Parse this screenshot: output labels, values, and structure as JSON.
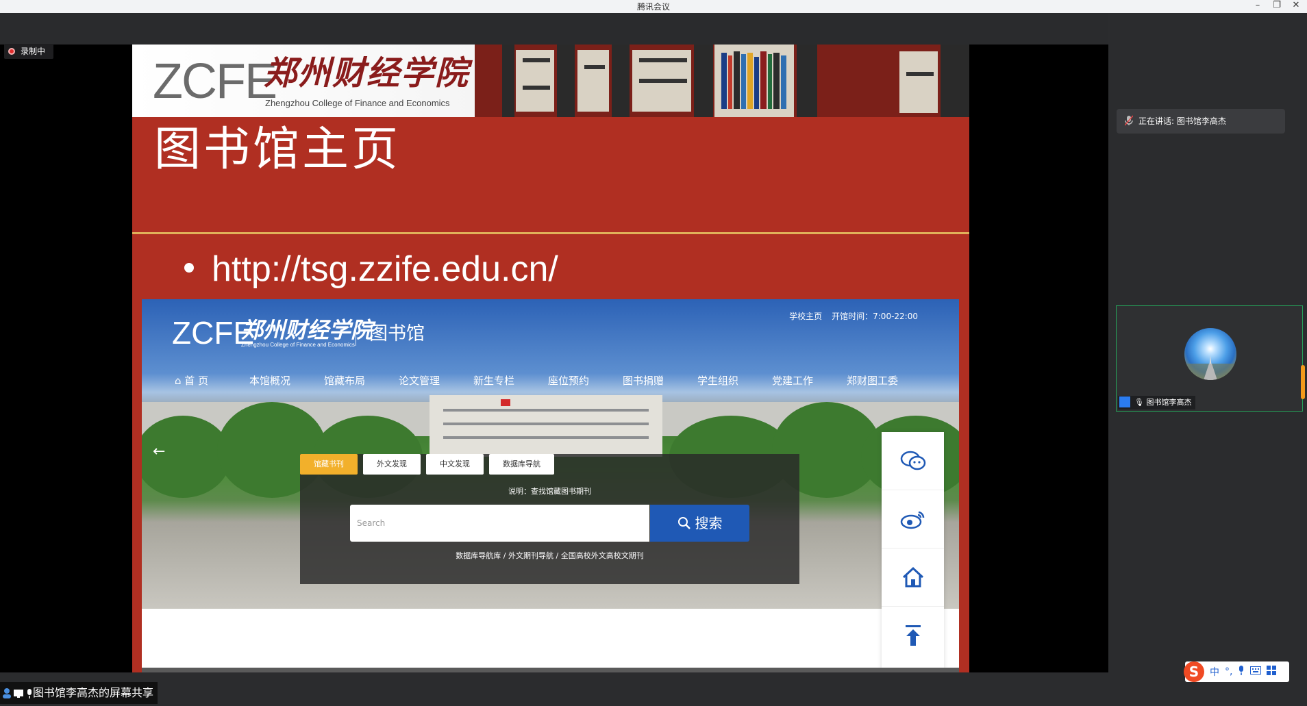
{
  "window": {
    "title": "腾讯会议",
    "controls": [
      "minimize-icon",
      "restore-icon",
      "close-icon"
    ]
  },
  "recording": {
    "label": "录制中",
    "color": "#e02b2b"
  },
  "slide": {
    "banner": {
      "logo_latin": "ZCFE",
      "logo_cn": "郑州财经学院",
      "logo_en": "Zhengzhou College of Finance and Economics"
    },
    "title": "图书馆主页",
    "bullet_url": "http://tsg.zzife.edu.cn/",
    "website": {
      "logo_latin": "ZCFE",
      "logo_cn": "郑州财经学院",
      "logo_en": "Zhengzhou College of Finance and Economics",
      "section": "图书馆",
      "top_links": [
        "学校主页",
        "开馆时间：7:00-22:00"
      ],
      "nav": [
        "首 页",
        "本馆概况",
        "馆藏布局",
        "论文管理",
        "新生专栏",
        "座位预约",
        "图书捐赠",
        "学生组织",
        "党建工作",
        "郑财图工委"
      ],
      "search": {
        "tabs": [
          "馆藏书刊",
          "外文发现",
          "中文发现",
          "数据库导航"
        ],
        "active_tab": "馆藏书刊",
        "description": "说明：查找馆藏图书期刊",
        "placeholder": "Search",
        "button": "搜索",
        "links": "数据库导航库 / 外文期刊导航 / 全国高校外文高校文期刊"
      },
      "float_icons": [
        "wechat-icon",
        "weibo-icon",
        "home-icon",
        "back-to-top-icon"
      ]
    }
  },
  "right_panel": {
    "speaking": "正在讲话: 图书馆李高杰",
    "participant_name": "图书馆李高杰"
  },
  "bottom": {
    "share_label": "图书馆李高杰的屏幕共享"
  },
  "ime": {
    "logo": "S",
    "items": [
      "中",
      "°,",
      "mic-icon",
      "keyboard-icon",
      "grid-icon"
    ]
  },
  "colors": {
    "slide_red": "#b02f22",
    "accent_gold": "#e1b15a",
    "active_tab": "#f2b02b",
    "search_blue": "#1f59b5",
    "tile_border": "#26a35a"
  }
}
